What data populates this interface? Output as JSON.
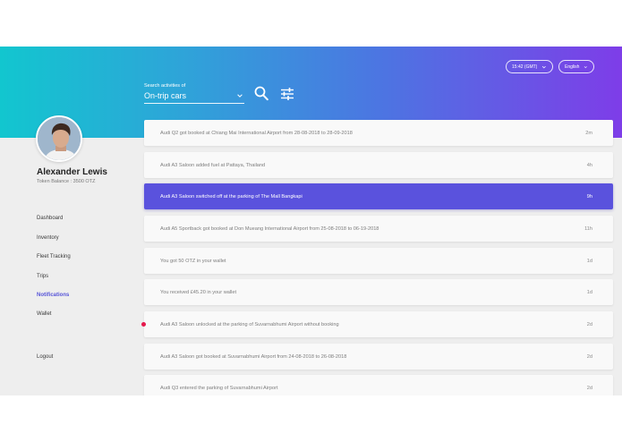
{
  "header": {
    "time_label": "15:42 (GMT)",
    "language_label": "English",
    "search_label": "Search activities of",
    "search_value": "On-trip cars"
  },
  "profile": {
    "name": "Alexander Lewis",
    "token_balance": "Token Balance : 3500 OTZ"
  },
  "nav": {
    "items": [
      {
        "label": "Dashboard"
      },
      {
        "label": "Inventory"
      },
      {
        "label": "Fleet Tracking"
      },
      {
        "label": "Trips"
      },
      {
        "label": "Notifications"
      },
      {
        "label": "Wallet"
      }
    ],
    "active": "Notifications",
    "logout": "Logout"
  },
  "notifications": [
    {
      "text": "Audi Q2 got booked at Chiang Mai International Airport from 28-08-2018 to 28-09-2018",
      "time": "2m"
    },
    {
      "text": "Audi A3 Saloon added fuel at Pattaya, Thailand",
      "time": "4h"
    },
    {
      "text": "Audi A3 Saloon switched off at the parking of The Mall Bangkapi",
      "time": "9h"
    },
    {
      "text": "Audi A5 Sportback got booked at Don Mueang International Airport from 25-08-2018 to 06-19-2018",
      "time": "11h"
    },
    {
      "text": "You got 50 OTZ in your wallet",
      "time": "1d"
    },
    {
      "text": "You received £45.20 in your wallet",
      "time": "1d"
    },
    {
      "text": "Audi A3 Saloon unlocked at the parking of Suvarnabhumi Airport without booking",
      "time": "2d"
    },
    {
      "text": "Audi A3 Saloon got booked at Suvarnabhumi Airport from 24-08-2018 to 26-08-2018",
      "time": "2d"
    },
    {
      "text": "Audi Q3 entered the parking of Suvarnabhumi Airport",
      "time": "2d"
    }
  ],
  "colors": {
    "gradient_start": "#12c6cf",
    "gradient_end": "#7e3de8",
    "active_row": "#5a52dd",
    "active_nav": "#5654d8",
    "unread_dot": "#e5194d"
  },
  "icons": [
    "chevron-down-icon",
    "search-icon",
    "filter-sliders-icon",
    "unread-dot-icon"
  ]
}
